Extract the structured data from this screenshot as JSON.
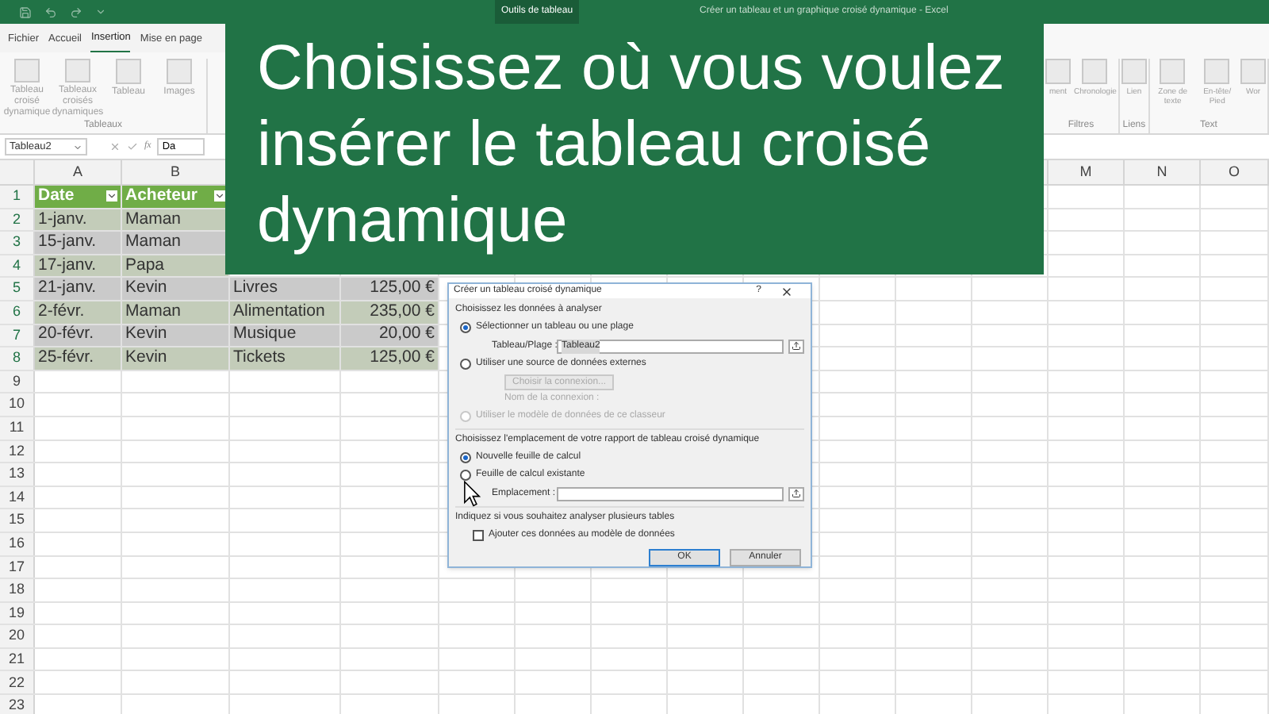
{
  "title_bar": {
    "context_tab": "Outils de tableau",
    "title": "Créer un tableau et un graphique croisé dynamique  -  Excel"
  },
  "ribbon": {
    "tabs": [
      {
        "label": "Fichier",
        "selected": false
      },
      {
        "label": "Accueil",
        "selected": false
      },
      {
        "label": "Insertion",
        "selected": true
      },
      {
        "label": "Mise en page",
        "selected": false
      }
    ],
    "left_groups": [
      {
        "label": "Tableaux",
        "items": [
          "Tableau croisé dynamique",
          "Tableaux croisés dynamiques",
          "Tableau",
          "Images"
        ]
      }
    ],
    "right_groups": [
      {
        "label": "Filtres",
        "items": [
          "ment",
          "Chronologie"
        ]
      },
      {
        "label": "Liens",
        "items": [
          "Lien"
        ]
      },
      {
        "label": "Text",
        "items": [
          "Zone de texte",
          "En-tête/ Pied",
          "Wor"
        ]
      }
    ]
  },
  "formula_bar": {
    "name_box": "Tableau2",
    "function_label": "fx",
    "formula": "Da"
  },
  "banner": {
    "text": "Choisissez où vous voulez insérer le tableau croisé dynamique"
  },
  "sheet": {
    "column_headers": [
      "A",
      "B",
      "M",
      "N",
      "O"
    ],
    "rows": [
      {
        "number": "1",
        "kind": "header",
        "cells": [
          "Date",
          "Acheteur"
        ]
      },
      {
        "number": "2",
        "kind": "data",
        "cells": [
          "1-janv.",
          "Maman"
        ]
      },
      {
        "number": "3",
        "kind": "data",
        "cells": [
          "15-janv.",
          "Maman"
        ]
      },
      {
        "number": "4",
        "kind": "data",
        "cells": [
          "17-janv.",
          "Papa"
        ]
      },
      {
        "number": "5",
        "kind": "data",
        "cells": [
          "21-janv.",
          "Kevin",
          "Livres",
          "125,00 €"
        ]
      },
      {
        "number": "6",
        "kind": "data",
        "cells": [
          "2-févr.",
          "Maman",
          "Alimentation",
          "235,00 €"
        ]
      },
      {
        "number": "7",
        "kind": "data",
        "cells": [
          "20-févr.",
          "Kevin",
          "Musique",
          "20,00 €"
        ]
      },
      {
        "number": "8",
        "kind": "data",
        "cells": [
          "25-févr.",
          "Kevin",
          "Tickets",
          "125,00 €"
        ]
      },
      {
        "number": "9",
        "kind": "empty"
      },
      {
        "number": "10",
        "kind": "empty"
      },
      {
        "number": "11",
        "kind": "empty"
      },
      {
        "number": "12",
        "kind": "empty"
      },
      {
        "number": "13",
        "kind": "empty"
      },
      {
        "number": "14",
        "kind": "empty"
      },
      {
        "number": "15",
        "kind": "empty"
      },
      {
        "number": "16",
        "kind": "empty"
      },
      {
        "number": "17",
        "kind": "empty"
      },
      {
        "number": "18",
        "kind": "empty"
      },
      {
        "number": "19",
        "kind": "empty"
      },
      {
        "number": "20",
        "kind": "empty"
      },
      {
        "number": "21",
        "kind": "empty"
      },
      {
        "number": "22",
        "kind": "empty"
      },
      {
        "number": "23",
        "kind": "empty"
      }
    ]
  },
  "dialog": {
    "title": "Créer un tableau croisé dynamique",
    "help": "?",
    "sections": [
      {
        "label": "Choisissez les données à analyser",
        "items": [
          {
            "kind": "radio",
            "label": "Sélectionner un tableau ou une plage",
            "selected": true,
            "disabled": false
          },
          {
            "kind": "field",
            "label": "Tableau/Plage :",
            "value": "Tableau2",
            "disabled": false
          },
          {
            "kind": "radio",
            "label": "Utiliser une source de données externes",
            "selected": false,
            "disabled": false
          },
          {
            "kind": "button",
            "label": "Choisir la connexion...",
            "disabled": true
          },
          {
            "kind": "text",
            "label": "Nom de la connexion :",
            "disabled": true
          },
          {
            "kind": "radio",
            "label": "Utiliser le modèle de données de ce classeur",
            "selected": false,
            "disabled": true
          }
        ]
      },
      {
        "label": "Choisissez l'emplacement de votre rapport de tableau croisé dynamique",
        "items": [
          {
            "kind": "radio",
            "label": "Nouvelle feuille de calcul",
            "selected": true,
            "disabled": false
          },
          {
            "kind": "radio",
            "label": "Feuille de calcul existante",
            "selected": false,
            "disabled": false
          },
          {
            "kind": "field",
            "label": "Emplacement :",
            "disabled": false
          }
        ]
      },
      {
        "label": "Indiquez si vous souhaitez analyser plusieurs tables",
        "items": [
          {
            "kind": "checkbox",
            "label": "Ajouter ces données au modèle de données",
            "checked": false,
            "disabled": false
          }
        ]
      }
    ],
    "buttons": [
      {
        "label": "OK",
        "selected": true
      },
      {
        "label": "Annuler",
        "selected": false
      }
    ]
  }
}
